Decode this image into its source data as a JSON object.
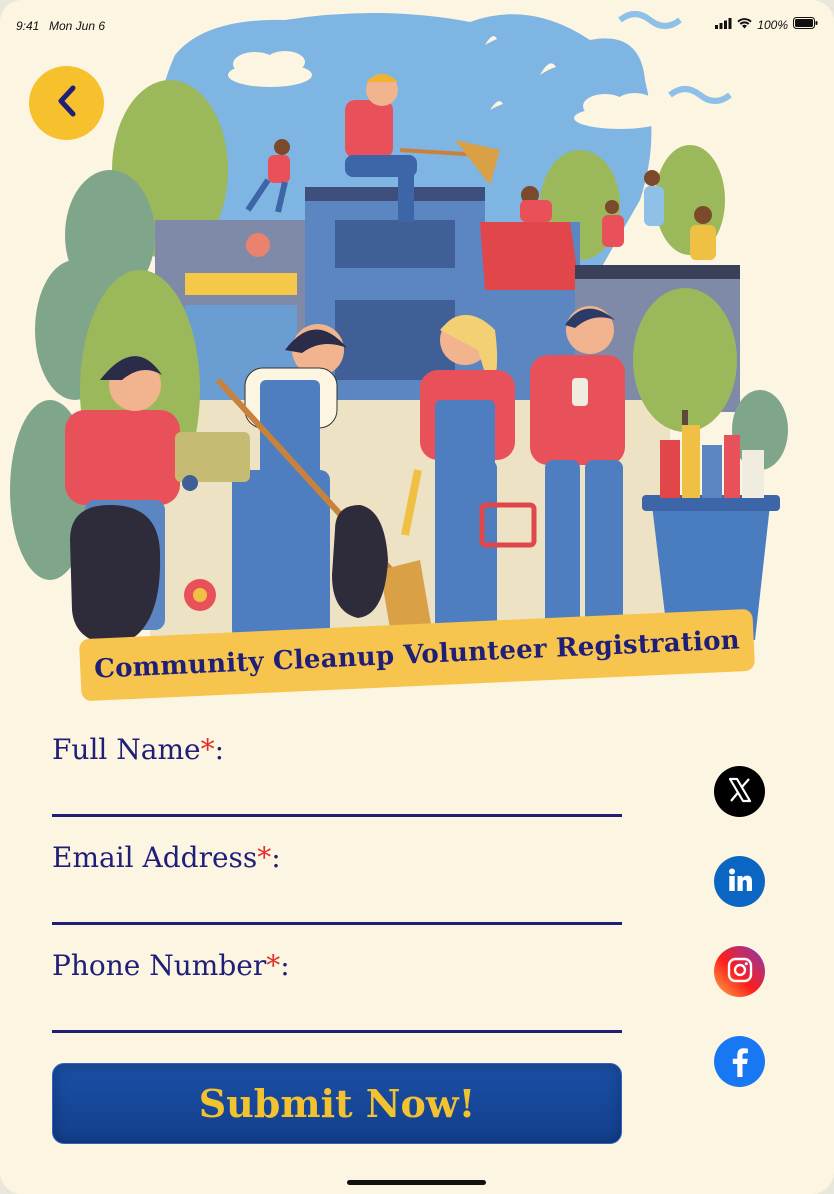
{
  "status_bar": {
    "time": "9:41",
    "date": "Mon Jun 6",
    "battery": "100%"
  },
  "header": {
    "back_icon": "chevron-left-icon",
    "banner_title": "Community Cleanup Volunteer Registration"
  },
  "form": {
    "fields": [
      {
        "label": "Full Name",
        "required_mark": "*",
        "suffix": ":",
        "value": ""
      },
      {
        "label": "Email Address",
        "required_mark": "*",
        "suffix": ":",
        "value": ""
      },
      {
        "label": "Phone Number",
        "required_mark": "*",
        "suffix": ":",
        "value": ""
      }
    ],
    "submit_label": "Submit Now!"
  },
  "social": [
    {
      "icon": "x-twitter-icon",
      "color": "#000000"
    },
    {
      "icon": "linkedin-icon",
      "color": "#0a66c2"
    },
    {
      "icon": "instagram-icon",
      "color": "#e1306c"
    },
    {
      "icon": "facebook-icon",
      "color": "#1877f2"
    }
  ],
  "colors": {
    "background": "#fcf5e2",
    "accent_yellow": "#f7c12d",
    "navy": "#1f1f78",
    "required": "#e0302b",
    "button": "#1b4fa5",
    "button_text": "#f2c230"
  }
}
